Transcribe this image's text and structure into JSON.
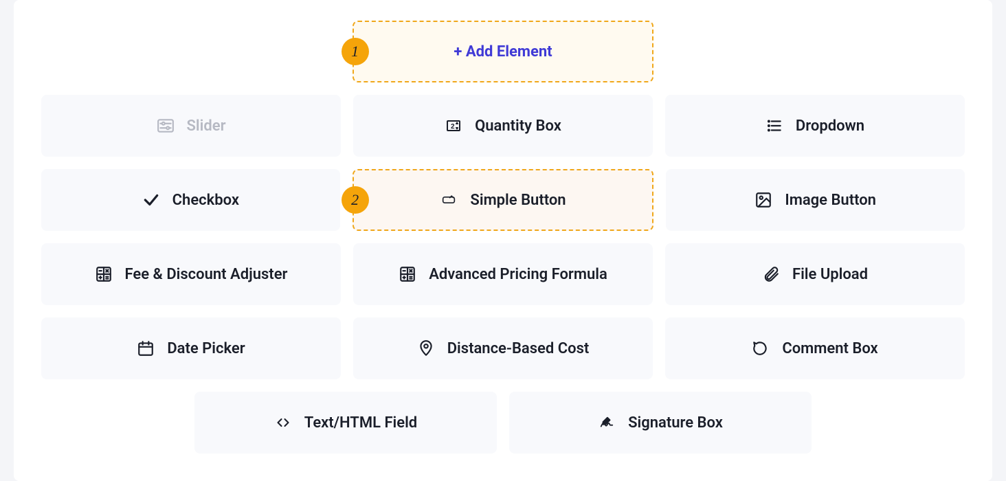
{
  "badges": {
    "one": "1",
    "two": "2"
  },
  "add_element": "+ Add Element",
  "elements": {
    "slider": "Slider",
    "quantity_box": "Quantity Box",
    "dropdown": "Dropdown",
    "checkbox": "Checkbox",
    "simple_button": "Simple Button",
    "image_button": "Image Button",
    "fee_discount": "Fee & Discount Adjuster",
    "advanced_pricing": "Advanced Pricing Formula",
    "file_upload": "File Upload",
    "date_picker": "Date Picker",
    "distance_cost": "Distance-Based Cost",
    "comment_box": "Comment Box",
    "text_html": "Text/HTML Field",
    "signature_box": "Signature Box"
  }
}
